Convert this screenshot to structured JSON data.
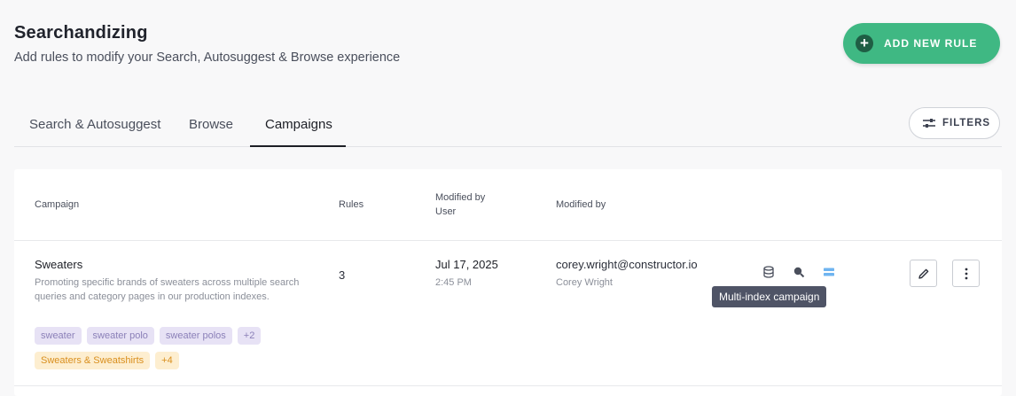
{
  "header": {
    "title": "Searchandizing",
    "subtitle": "Add rules to modify your Search, Autosuggest & Browse experience",
    "add_rule_label": "ADD NEW RULE"
  },
  "tabs": [
    {
      "label": "Search & Autosuggest",
      "active": false
    },
    {
      "label": "Browse",
      "active": false
    },
    {
      "label": "Campaigns",
      "active": true
    }
  ],
  "filters_label": "FILTERS",
  "table": {
    "columns": {
      "campaign": "Campaign",
      "rules": "Rules",
      "modified_by_user_1": "Modified by",
      "modified_by_user_2": "User",
      "modified_by": "Modified by"
    },
    "rows": [
      {
        "name": "Sweaters",
        "description": "Promoting specific brands of sweaters across multiple search queries and category pages in our production indexes.",
        "query_tags": [
          "sweater",
          "sweater polo",
          "sweater polos",
          "+2"
        ],
        "category_tags": [
          "Sweaters & Sweatshirts",
          "+4"
        ],
        "rules": "3",
        "modified_date": "Jul 17, 2025",
        "modified_time": "2:45 PM",
        "modified_email": "corey.wright@constructor.io",
        "modified_name": "Corey Wright",
        "tooltip": "Multi-index campaign"
      }
    ]
  },
  "colors": {
    "accent_green": "#3fb883",
    "tag_purple_bg": "#e7e2f5",
    "tag_orange_bg": "#fdeed0",
    "tooltip_bg": "#4f5466"
  }
}
